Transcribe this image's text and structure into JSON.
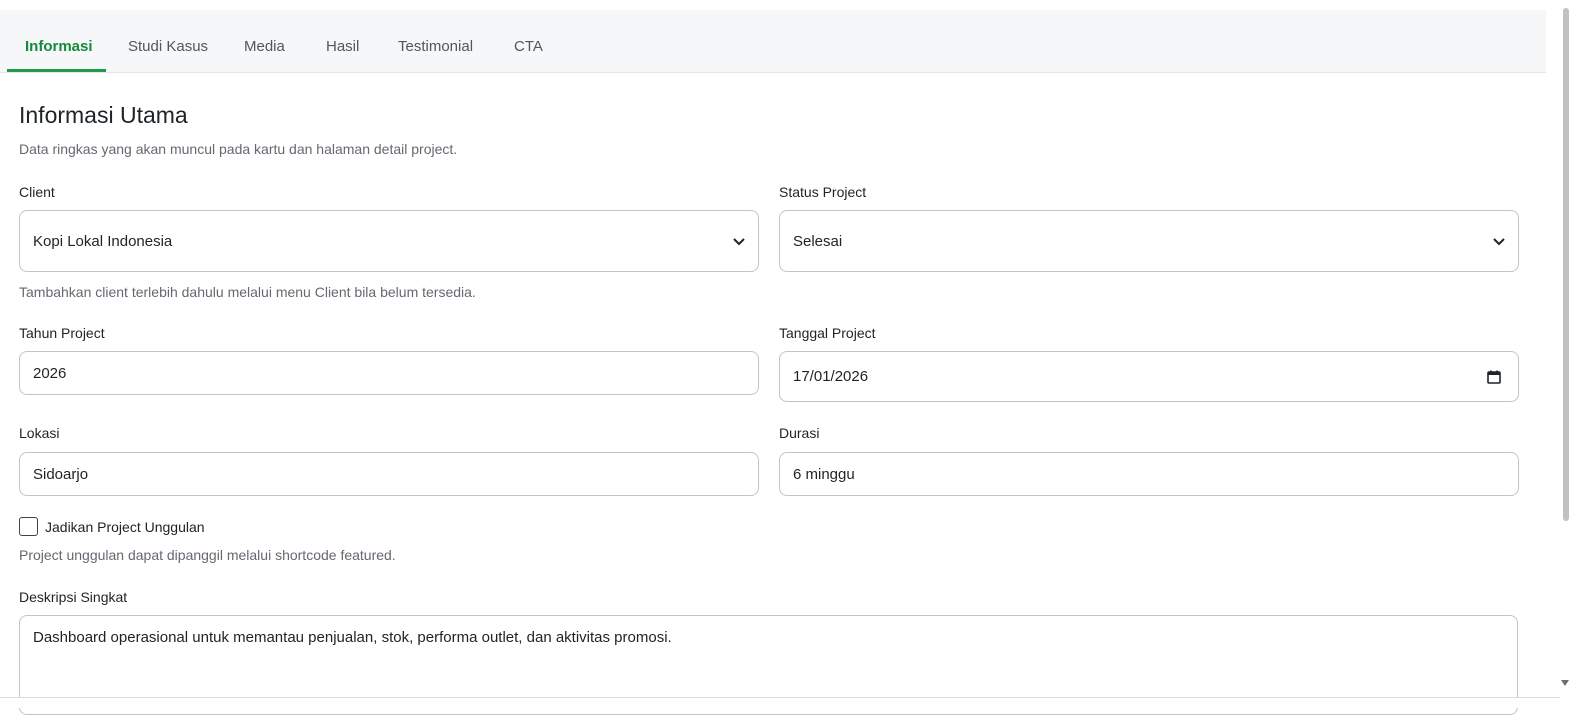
{
  "tabs": [
    {
      "label": "Informasi",
      "active": true
    },
    {
      "label": "Studi Kasus",
      "active": false
    },
    {
      "label": "Media",
      "active": false
    },
    {
      "label": "Hasil",
      "active": false
    },
    {
      "label": "Testimonial",
      "active": false
    },
    {
      "label": "CTA",
      "active": false
    }
  ],
  "section": {
    "title": "Informasi Utama",
    "description": "Data ringkas yang akan muncul pada kartu dan halaman detail project."
  },
  "fields": {
    "client": {
      "label": "Client",
      "value": "Kopi Lokal Indonesia",
      "help": "Tambahkan client terlebih dahulu melalui menu Client bila belum tersedia."
    },
    "status": {
      "label": "Status Project",
      "value": "Selesai"
    },
    "year": {
      "label": "Tahun Project",
      "value": "2026"
    },
    "date": {
      "label": "Tanggal Project",
      "value": "17/01/2026"
    },
    "location": {
      "label": "Lokasi",
      "value": "Sidoarjo"
    },
    "duration": {
      "label": "Durasi",
      "value": "6 minggu"
    },
    "featured": {
      "label": "Jadikan Project Unggulan",
      "checked": false,
      "help": "Project unggulan dapat dipanggil melalui shortcode featured."
    },
    "short_description": {
      "label": "Deskripsi Singkat",
      "value": "Dashboard operasional untuk memantau penjualan, stok, performa outlet, dan aktivitas promosi."
    }
  },
  "colors": {
    "accent": "#1f9a45",
    "tab_active_text": "#15893b",
    "muted_text": "#646970",
    "border": "#c3c4c7"
  }
}
